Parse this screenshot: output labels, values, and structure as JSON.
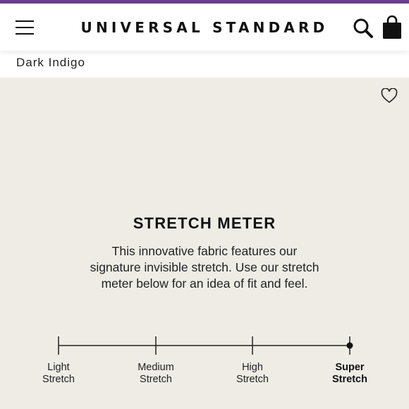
{
  "header": {
    "brand": "UNIVERSAL STANDARD",
    "icons": {
      "menu": "hamburger-menu-icon",
      "search": "search-icon",
      "bag": "shopping-bag-icon"
    },
    "accent_color": "#6a3d8f"
  },
  "product": {
    "color_name": "Dark Indigo",
    "wishlist_icon": "heart-icon"
  },
  "stretch_meter": {
    "title": "STRETCH METER",
    "description_lines": [
      "This innovative fabric features our",
      "signature invisible stretch. Use our stretch",
      "meter below for an idea of fit and feel."
    ],
    "levels": [
      {
        "line1": "Light",
        "line2": "Stretch"
      },
      {
        "line1": "Medium",
        "line2": "Stretch"
      },
      {
        "line1": "High",
        "line2": "Stretch"
      },
      {
        "line1": "Super",
        "line2": "Stretch"
      }
    ],
    "selected_level": "Super Stretch",
    "panel_color": "#efece6"
  }
}
